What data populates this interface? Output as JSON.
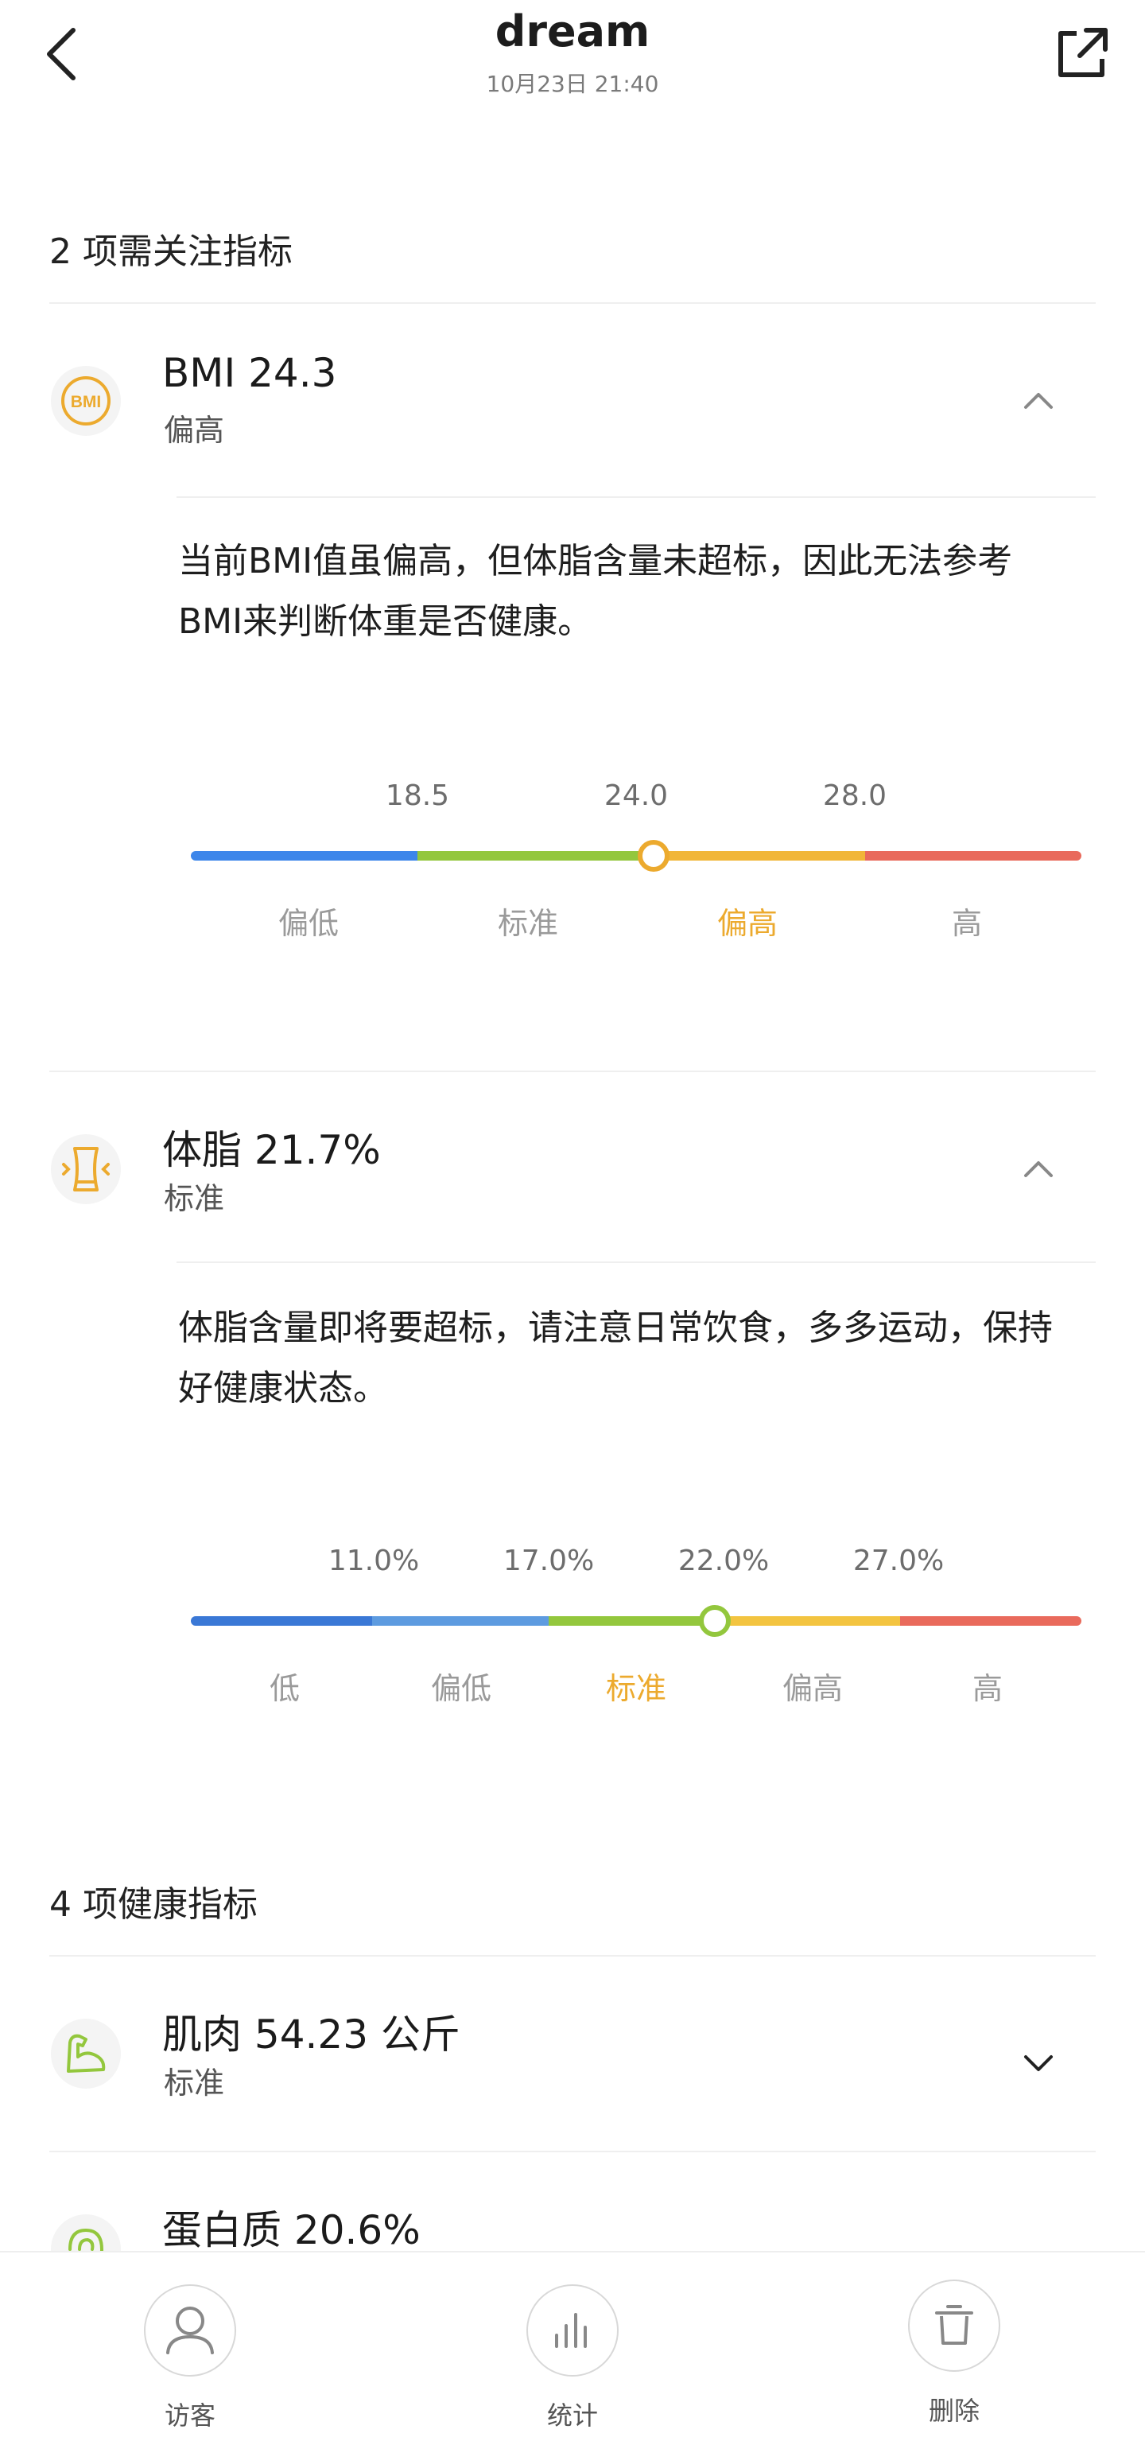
{
  "header": {
    "title": "dream",
    "subtitle": "10月23日 21:40"
  },
  "attention": {
    "section_title": "2 项需关注指标",
    "metrics": [
      {
        "name": "BMI  24.3",
        "status": "偏高",
        "icon": "bmi-icon",
        "icon_text": "BMI",
        "description": "当前BMI值虽偏高，但体脂含量未超标，因此无法参考BMI来判断体重是否健康。",
        "scale": {
          "ticks": [
            "18.5",
            "24.0",
            "28.0"
          ],
          "bands": [
            "偏低",
            "标准",
            "偏高",
            "高"
          ],
          "active_band": 2,
          "colors": [
            "#3d86ea",
            "#93c73d",
            "#f1b638",
            "#e96a5c"
          ],
          "marker_value": 24.3
        }
      },
      {
        "name": "体脂  21.7%",
        "status": "标准",
        "icon": "body-fat-icon",
        "description": "体脂含量即将要超标，请注意日常饮食，多多运动，保持好健康状态。",
        "scale": {
          "ticks": [
            "11.0%",
            "17.0%",
            "22.0%",
            "27.0%"
          ],
          "bands": [
            "低",
            "偏低",
            "标准",
            "偏高",
            "高"
          ],
          "active_band": 2,
          "colors": [
            "#3a78d6",
            "#5d9be0",
            "#93c73d",
            "#f3c440",
            "#e96a5c"
          ],
          "marker_value": 21.7
        }
      }
    ]
  },
  "health": {
    "section_title": "4 项健康指标",
    "metrics": [
      {
        "name": "肌肉  54.23 公斤",
        "status": "标准",
        "icon": "muscle-icon"
      },
      {
        "name": "蛋白质  20.6%",
        "status": "",
        "icon": "protein-icon"
      }
    ]
  },
  "bottom_nav": {
    "items": [
      {
        "label": "访客",
        "icon": "visitor-icon"
      },
      {
        "label": "统计",
        "icon": "stats-icon"
      },
      {
        "label": "删除",
        "icon": "trash-icon"
      }
    ]
  },
  "colors": {
    "accent_orange": "#ecaa2e",
    "green": "#93c73d"
  }
}
